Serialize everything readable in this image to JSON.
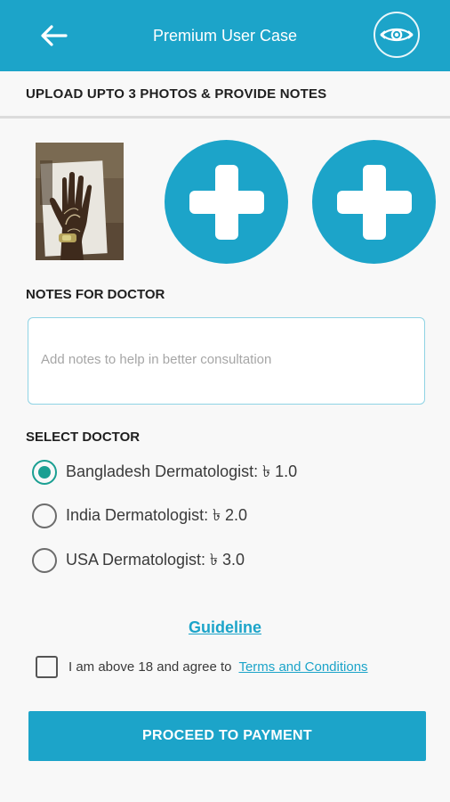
{
  "header": {
    "title": "Premium User Case",
    "back_icon": "arrow-left-icon",
    "eye_icon": "eye-icon"
  },
  "upload": {
    "heading": "UPLOAD UPTO 3 PHOTOS & PROVIDE NOTES",
    "photo_alt": "uploaded-photo-hand",
    "add_icon": "plus-icon"
  },
  "notes": {
    "label": "NOTES FOR DOCTOR",
    "value": "",
    "placeholder": "Add notes to help in better consultation"
  },
  "doctor": {
    "label": "SELECT DOCTOR",
    "options": [
      {
        "label": "Bangladesh Dermatologist: ৳ 1.0",
        "selected": true
      },
      {
        "label": "India Dermatologist: ৳ 2.0",
        "selected": false
      },
      {
        "label": "USA Dermatologist: ৳ 3.0",
        "selected": false
      }
    ]
  },
  "guideline": {
    "label": "Guideline"
  },
  "agreement": {
    "text": "I am above 18 and agree to",
    "link": "Terms and Conditions",
    "checked": false
  },
  "proceed": {
    "label": "PROCEED TO PAYMENT"
  },
  "colors": {
    "primary": "#1ca4c9",
    "radio_selected": "#1a9f92",
    "background": "#f8f8f8"
  }
}
